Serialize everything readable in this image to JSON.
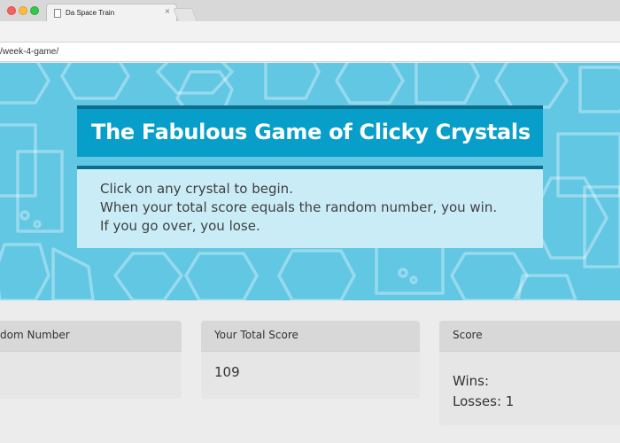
{
  "browser": {
    "tab_title": "Da Space Train",
    "tab_close": "×",
    "url": "/week-4-game/"
  },
  "hero": {
    "title": "The Fabulous Game of Clicky Crystals",
    "instructions": [
      "Click on any crystal to begin.",
      "When your total score equals the random number, you win.",
      "If you go over, you lose."
    ]
  },
  "panels": {
    "random_number": {
      "heading": "dom Number",
      "value": ""
    },
    "total_score": {
      "heading": "Your Total Score",
      "value": "109"
    },
    "score": {
      "heading": "Score",
      "wins": "Wins:",
      "losses": "Losses: 1"
    }
  },
  "colors": {
    "hero_bg": "#62c7e3",
    "title_bg": "#079ec9",
    "accent_border": "#0a6f8e",
    "instructions_bg": "#c9ecf7",
    "page_bg": "#ececec"
  },
  "icons": [
    "document-icon",
    "close-icon",
    "crystal-icon"
  ]
}
